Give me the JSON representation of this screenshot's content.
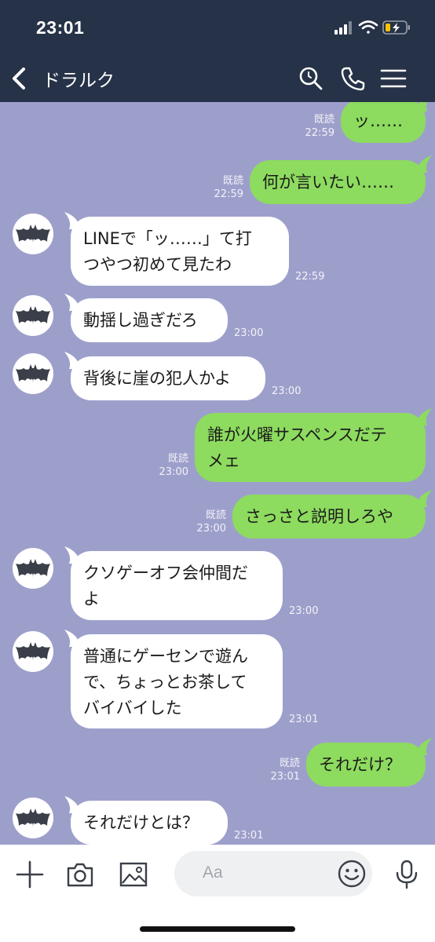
{
  "status": {
    "time": "23:01"
  },
  "header": {
    "title": "ドラルク"
  },
  "messages": [
    {
      "dir": "out",
      "text": "ッ……",
      "read": "既読",
      "time": "22:59"
    },
    {
      "dir": "out",
      "text": "何が言いたい……",
      "read": "既読",
      "time": "22:59"
    },
    {
      "dir": "in",
      "text": "LINEで「ッ……」て打\nつやつ初めて見たわ",
      "time": "22:59"
    },
    {
      "dir": "in",
      "text": "動揺し過ぎだろ",
      "time": "23:00"
    },
    {
      "dir": "in",
      "text": "背後に崖の犯人かよ",
      "time": "23:00"
    },
    {
      "dir": "out",
      "text": "誰が火曜サスペンスだテ\nメェ",
      "read": "既読",
      "time": "23:00"
    },
    {
      "dir": "out",
      "text": "さっさと説明しろや",
      "read": "既読",
      "time": "23:00"
    },
    {
      "dir": "in",
      "text": "クソゲーオフ会仲間だ\nよ",
      "time": "23:00"
    },
    {
      "dir": "in",
      "text": "普通にゲーセンで遊ん\nで、ちょっとお茶して\nバイバイした",
      "time": "23:01"
    },
    {
      "dir": "out",
      "text": "それだけ？",
      "read": "既読",
      "time": "23:01"
    },
    {
      "dir": "in",
      "text": "それだけとは？",
      "time": "23:01"
    }
  ],
  "input": {
    "placeholder": "Aa"
  },
  "icons": {
    "back": "chevron-left-icon",
    "search": "search-icon",
    "call": "phone-icon",
    "menu": "hamburger-menu-icon",
    "plus": "plus-icon",
    "camera": "camera-icon",
    "image": "image-icon",
    "emoji": "smiley-icon",
    "mic": "microphone-icon",
    "avatar": "bat-icon"
  },
  "colors": {
    "header_bg": "#263247",
    "chat_bg": "#9d9fcb",
    "outgoing_bubble": "#8ddb5f",
    "incoming_bubble": "#ffffff"
  }
}
